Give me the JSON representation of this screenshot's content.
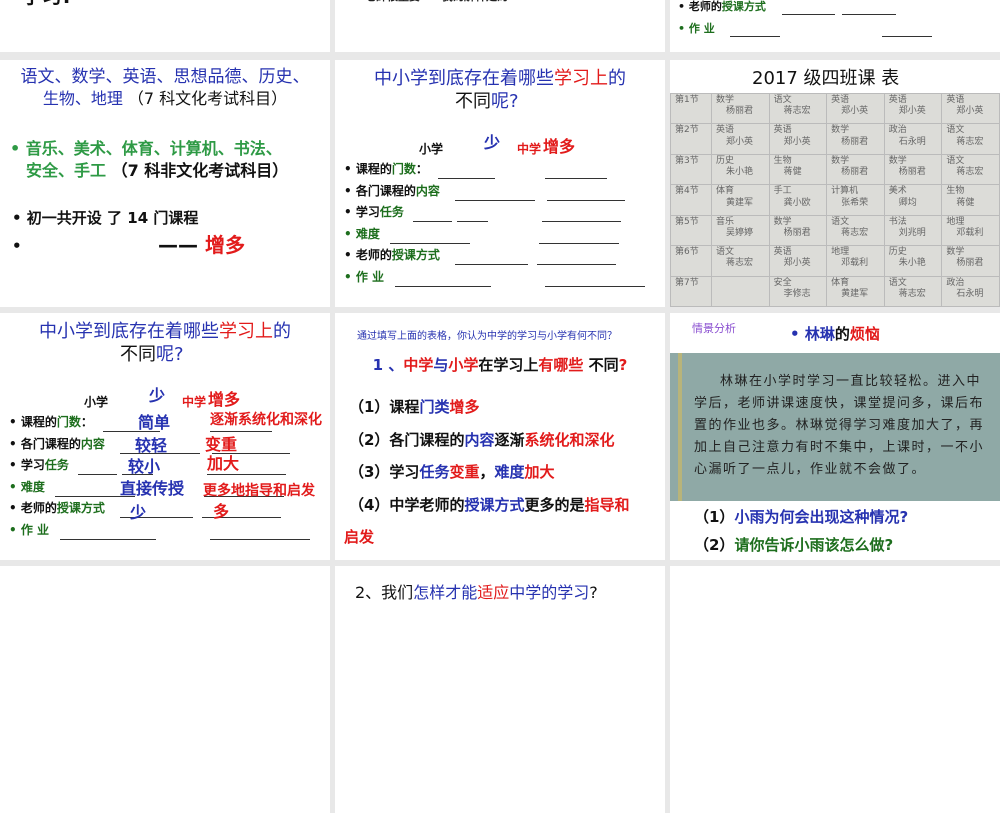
{
  "colors": {
    "blue": "#2632b0",
    "red": "#e21b1b",
    "green": "#2e9a45",
    "dgreen": "#1d6e1d",
    "black": "#111111",
    "purple": "#8a4fd0"
  },
  "slides": {
    "top_left": {
      "text": "学习!"
    },
    "top_mid": {
      "text": "老師很重要……我的解释是的"
    },
    "top_right": {
      "rows": [
        [
          {
            "t": "• 老师的",
            "c": "black"
          },
          {
            "t": "授课方式",
            "c": "dgreen"
          }
        ],
        [
          {
            "t": "• 作 业",
            "c": "dgreen"
          }
        ]
      ]
    },
    "subjects": {
      "lines": [
        [
          {
            "t": "语文、数学、英语、思想品德、历史、",
            "c": "blue"
          }
        ],
        [
          {
            "t": "生物、地理 ",
            "c": "blue"
          },
          {
            "t": "（7 科文化考试科目）",
            "c": "black"
          }
        ],
        [
          {
            "t": "• 音乐、美术、体育、计算机、书法、",
            "c": "green"
          }
        ],
        [
          {
            "t": "安全、手工 ",
            "c": "green"
          },
          {
            "t": "（7 科非文化考试科目）",
            "c": "black"
          }
        ],
        [
          {
            "t": "• 初一共开设 了 14 门课程",
            "c": "black"
          }
        ],
        [
          {
            "t": "•",
            "c": "black"
          }
        ],
        [
          {
            "t": "—— ",
            "c": "black"
          },
          {
            "t": "增多",
            "c": "red"
          }
        ]
      ]
    },
    "compare": {
      "title1": [
        {
          "t": "中小学到底存在着哪些",
          "c": "blue"
        },
        {
          "t": "学习上",
          "c": "red"
        },
        {
          "t": "的",
          "c": "blue"
        }
      ],
      "title2": [
        {
          "t": "不同",
          "c": "black"
        },
        {
          "t": "呢?",
          "c": "blue"
        }
      ],
      "primary": "小学",
      "less": "少",
      "middle": "中学",
      "more": "增多",
      "rows": [
        [
          {
            "t": "• 课程的",
            "c": "black"
          },
          {
            "t": "门数",
            "c": "dgreen"
          },
          {
            "t": "：",
            "c": "black"
          }
        ],
        [
          {
            "t": "• 各门课程的",
            "c": "black"
          },
          {
            "t": "内容",
            "c": "dgreen"
          }
        ],
        [
          {
            "t": "• 学习",
            "c": "black"
          },
          {
            "t": "任务",
            "c": "dgreen"
          }
        ],
        [
          {
            "t": "• 难度",
            "c": "dgreen"
          }
        ],
        [
          {
            "t": "• 老师的",
            "c": "black"
          },
          {
            "t": "授课方式",
            "c": "dgreen"
          }
        ],
        [
          {
            "t": "• 作 业",
            "c": "dgreen"
          }
        ]
      ]
    },
    "timetable": {
      "title": "2017 级四班课  表",
      "rows": [
        {
          "period": "第1节",
          "cells": [
            [
              "数学",
              "杨丽君"
            ],
            [
              "语文",
              "蒋志宏"
            ],
            [
              "英语",
              "郑小英"
            ],
            [
              "英语",
              "郑小英"
            ],
            [
              "英语",
              "郑小英"
            ]
          ]
        },
        {
          "period": "第2节",
          "cells": [
            [
              "英语",
              "郑小英"
            ],
            [
              "英语",
              "郑小英"
            ],
            [
              "数学",
              "杨丽君"
            ],
            [
              "政治",
              "石永明"
            ],
            [
              "语文",
              "蒋志宏"
            ]
          ]
        },
        {
          "period": "第3节",
          "cells": [
            [
              "历史",
              "朱小艳"
            ],
            [
              "生物",
              "蒋健"
            ],
            [
              "数学",
              "杨丽君"
            ],
            [
              "数学",
              "杨丽君"
            ],
            [
              "语文",
              "蒋志宏"
            ]
          ]
        },
        {
          "period": "第4节",
          "cells": [
            [
              "体育",
              "黄建军"
            ],
            [
              "手工",
              "龚小欧"
            ],
            [
              "计算机",
              "张希荣"
            ],
            [
              "美术",
              "卿均"
            ],
            [
              "生物",
              "蒋健"
            ]
          ]
        },
        {
          "period": "第5节",
          "cells": [
            [
              "音乐",
              "吴婷婷"
            ],
            [
              "数学",
              "杨丽君"
            ],
            [
              "语文",
              "蒋志宏"
            ],
            [
              "书法",
              "刘兆明"
            ],
            [
              "地理",
              "邓载利"
            ]
          ]
        },
        {
          "period": "第6节",
          "cells": [
            [
              "语文",
              "蒋志宏"
            ],
            [
              "英语",
              "郑小英"
            ],
            [
              "地理",
              "邓载利"
            ],
            [
              "历史",
              "朱小艳"
            ],
            [
              "数学",
              "杨丽君"
            ]
          ]
        },
        {
          "period": "第7节",
          "cells": [
            [
              "",
              ""
            ],
            [
              "安全",
              "李修志"
            ],
            [
              "体育",
              "黄建军"
            ],
            [
              "语文",
              "蒋志宏"
            ],
            [
              "政治",
              "石永明"
            ]
          ]
        }
      ]
    },
    "answers": [
      {
        "t": "简单",
        "c": "blue"
      },
      {
        "t": "逐渐系统化和深化",
        "c": "red"
      },
      {
        "t": "较轻",
        "c": "blue"
      },
      {
        "t": "变重",
        "c": "red"
      },
      {
        "t": "较小",
        "c": "blue"
      },
      {
        "t": "加大",
        "c": "red"
      },
      {
        "t": "直接传授",
        "c": "blue"
      },
      {
        "t": "更多地指导和启发",
        "c": "red"
      },
      {
        "t": "少",
        "c": "blue"
      },
      {
        "t": "多",
        "c": "red"
      }
    ],
    "summary": {
      "intro": "通过填写上面的表格，你认为中学的学习与小学有何不同？",
      "heading": [
        {
          "t": "1 、",
          "c": "blue"
        },
        {
          "t": "中学",
          "c": "red"
        },
        {
          "t": "与",
          "c": "blue"
        },
        {
          "t": "小学",
          "c": "red"
        },
        {
          "t": "在学习上",
          "c": "black"
        },
        {
          "t": "有哪些",
          "c": "red"
        },
        {
          "t": " 不同",
          "c": "black"
        },
        {
          "t": "?",
          "c": "red"
        }
      ],
      "points": [
        [
          {
            "t": "（1）课程",
            "c": "black"
          },
          {
            "t": "门类",
            "c": "blue"
          },
          {
            "t": "增多",
            "c": "red"
          }
        ],
        [
          {
            "t": "（2）各门课程的",
            "c": "black"
          },
          {
            "t": "内容",
            "c": "blue"
          },
          {
            "t": "逐渐",
            "c": "black"
          },
          {
            "t": "系统化和深化",
            "c": "red"
          }
        ],
        [
          {
            "t": "（3）学习",
            "c": "black"
          },
          {
            "t": "任务",
            "c": "blue"
          },
          {
            "t": "变重",
            "c": "red"
          },
          {
            "t": "，",
            "c": "black"
          },
          {
            "t": "难度",
            "c": "blue"
          },
          {
            "t": "加大",
            "c": "red"
          }
        ],
        [
          {
            "t": "（4）中学老师的",
            "c": "black"
          },
          {
            "t": "授课方式",
            "c": "blue"
          },
          {
            "t": "更多的是",
            "c": "black"
          },
          {
            "t": "指导和",
            "c": "red"
          }
        ],
        [
          {
            "t": "启发",
            "c": "red"
          }
        ]
      ]
    },
    "scenario": {
      "tag": "情景分析",
      "title": [
        {
          "t": "• ",
          "c": "blue"
        },
        {
          "t": "林琳",
          "c": "blue"
        },
        {
          "t": "的",
          "c": "black"
        },
        {
          "t": "烦恼",
          "c": "red"
        }
      ],
      "story": "林琳在小学时学习一直比较轻松。进入中学后，老师讲课速度快，课堂提问多，课后布置的作业也多。林琳觉得学习难度加大了，再加上自己注意力有时不集中，上课时，一不小心漏听了一点儿，作业就不会做了。",
      "q1": [
        {
          "t": "（1）",
          "c": "black"
        },
        {
          "t": "小雨为何会出现这种情况?",
          "c": "blue"
        }
      ],
      "q2": [
        {
          "t": "（2）",
          "c": "black"
        },
        {
          "t": "请你告诉小雨该怎么做?",
          "c": "dgreen"
        }
      ]
    },
    "bottom_mid": {
      "line": [
        {
          "t": "2、我们",
          "c": "black"
        },
        {
          "t": "怎样才能",
          "c": "blue"
        },
        {
          "t": "适应",
          "c": "red"
        },
        {
          "t": "中学的学习",
          "c": "blue"
        },
        {
          "t": "?",
          "c": "black"
        }
      ]
    }
  }
}
